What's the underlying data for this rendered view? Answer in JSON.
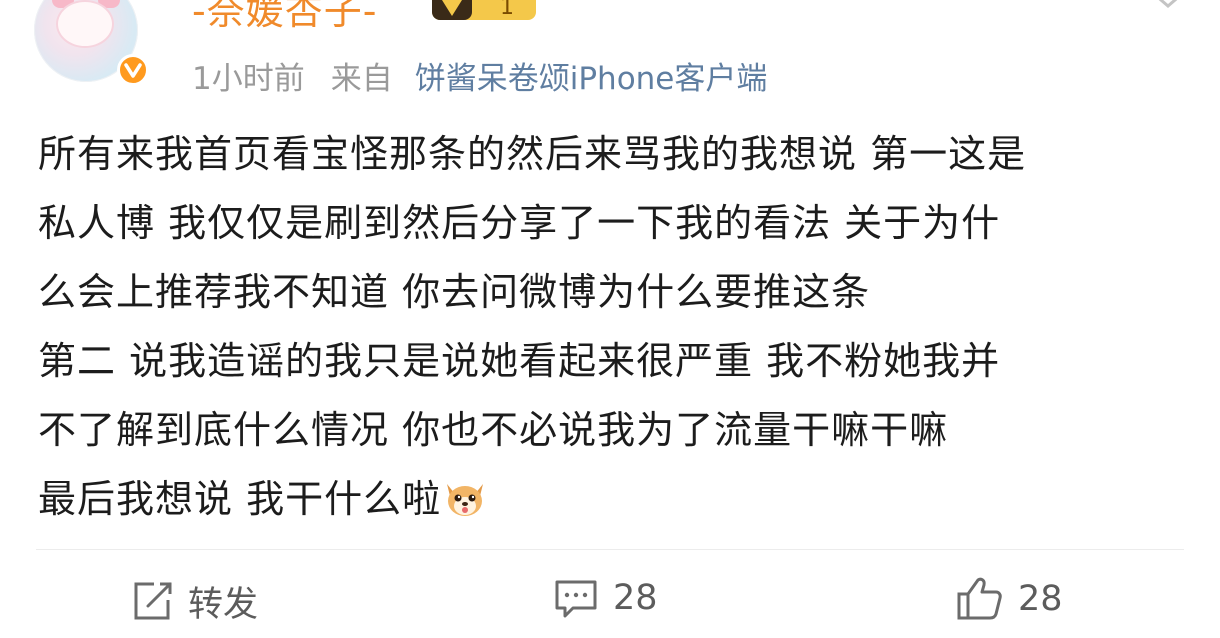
{
  "post": {
    "username": "-奈媛杏子-",
    "level_badge": "1",
    "time": "1小时前",
    "from_label": "来自",
    "source": "饼酱呆卷颂iPhone客户端",
    "content_lines": [
      "所有来我首页看宝怪那条的然后来骂我的我想说 第一这是",
      "私人博 我仅仅是刷到然后分享了一下我的看法 关于为什",
      "么会上推荐我不知道 你去问微博为什么要推这条",
      "第二 说我造谣的我只是说她看起来很严重 我不粉她我并",
      "不了解到底什么情况 你也不必说我为了流量干嘛干嘛",
      "最后我想说 我干什么啦"
    ]
  },
  "actions": {
    "repost_label": "转发",
    "comment_count": "28",
    "like_count": "28"
  },
  "icons": {
    "avatar": "avatar-image",
    "verify": "verified-v-icon",
    "level": "level-badge-icon",
    "more": "chevron-down-icon",
    "emoji": "dog-face-emoji",
    "repost": "repost-icon",
    "comment": "comment-icon",
    "like": "like-thumb-icon"
  },
  "colors": {
    "username": "#f08a2b",
    "source_link": "#5f7ea1",
    "meta": "#9a9a9a",
    "verify": "#ff9a1e"
  }
}
